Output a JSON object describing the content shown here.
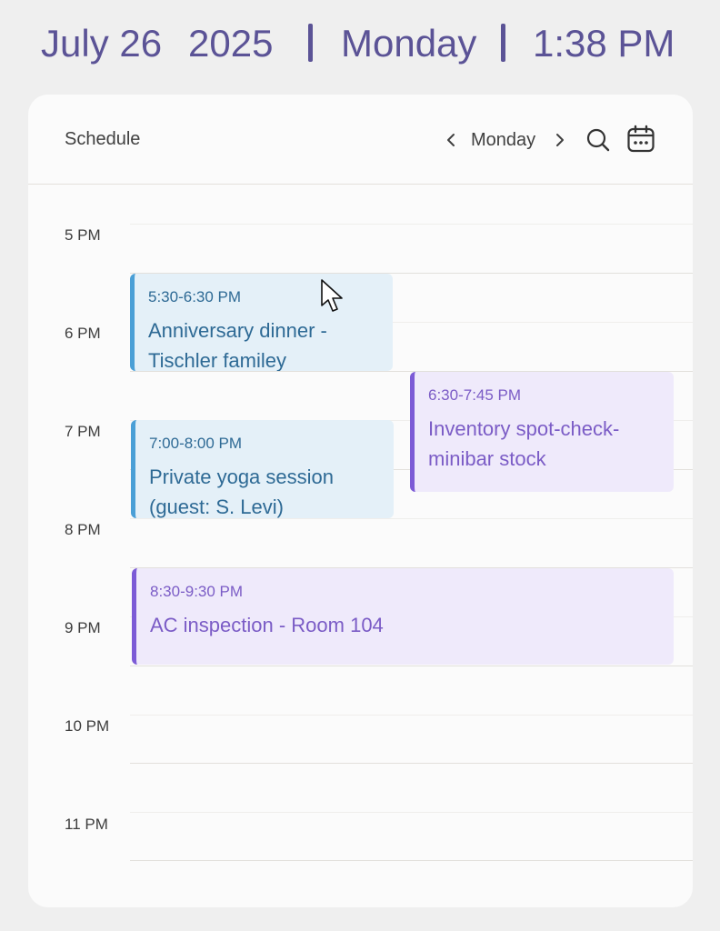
{
  "top_bar": {
    "date": "July 26",
    "year": "2025",
    "weekday": "Monday",
    "time": "1:38 PM"
  },
  "header": {
    "title": "Schedule",
    "day_label": "Monday",
    "prev_icon": "chevron-left-icon",
    "next_icon": "chevron-right-icon",
    "search_icon": "search-icon",
    "calendar_icon": "calendar-icon"
  },
  "hours": [
    "5 PM",
    "6 PM",
    "7 PM",
    "8 PM",
    "9 PM",
    "10 PM",
    "11 PM"
  ],
  "events": [
    {
      "time": "5:30-6:30  PM",
      "title": "Anniversary dinner -\nTischler familey",
      "color": "blue"
    },
    {
      "time": "6:30-7:45  PM",
      "title": "Inventory spot-check-\nminibar stock",
      "color": "purple"
    },
    {
      "time": "7:00-8:00  PM",
      "title": "Private yoga session\n(guest: S. Levi)",
      "color": "blue"
    },
    {
      "time": "8:30-9:30  PM",
      "title": "AC inspection - Room 104",
      "color": "purple"
    }
  ],
  "colors": {
    "accent": "#5b5396",
    "event_blue_bg": "#e4f0f8",
    "event_blue_border": "#4a9fd6",
    "event_purple_bg": "#efeafb",
    "event_purple_border": "#7c5bd6"
  }
}
